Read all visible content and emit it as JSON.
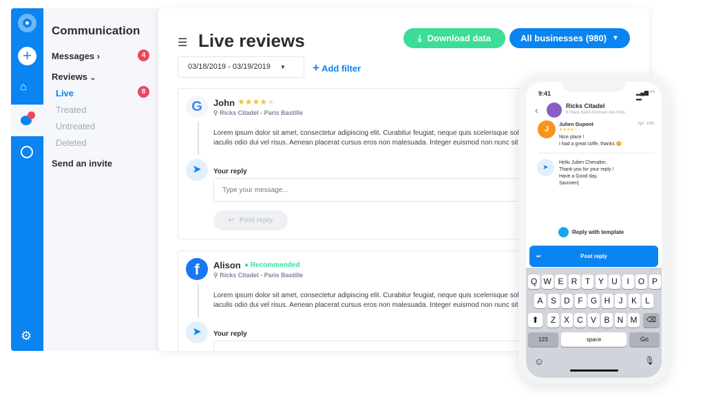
{
  "sidebar": {
    "title": "Communication",
    "items": [
      {
        "label": "Messages",
        "badge": "4"
      },
      {
        "label": "Reviews"
      }
    ],
    "sub_items": [
      {
        "label": "Live",
        "badge": "8"
      },
      {
        "label": "Treated"
      },
      {
        "label": "Untreated"
      },
      {
        "label": "Deleted"
      }
    ],
    "invite": "Send an invite"
  },
  "header": {
    "title": "Live reviews",
    "download": "Download data",
    "businesses": "All businesses (980)",
    "date_range": "03/18/2019 - 03/19/2019",
    "add_filter": "Add filter"
  },
  "reviews": [
    {
      "name": "John",
      "stars": 4,
      "location": "Ricks Citadel - Paris Bastille",
      "source": "google",
      "text1": "Lorem ipsum dolor sit amet, consectetur adipiscing elit. Curabitur feugiat, neque quis scelerisque sollicitudin,",
      "text2": "iaculis odio dui vel risus. Aenean placerat cursus eros non malesuada. Integer euismod non nunc sit amet faci",
      "reply_label": "Your reply",
      "placeholder": "Type your message...",
      "post": "Post reply"
    },
    {
      "name": "Alison",
      "badge": "Recommended",
      "location": "Ricks Citadel - Paris Bastille",
      "source": "facebook",
      "text1": "Lorem ipsum dolor sit amet, consectetur adipiscing elit. Curabitur feugiat, neque quis scelerisque sollicitudin,",
      "text2": "iaculis odio dui vel risus. Aenean placerat cursus eros non malesuada. Integer euismod non nunc sit amet faci",
      "reply_label": "Your reply"
    }
  ],
  "phone": {
    "time": "9:41",
    "business": "Ricks Citadel",
    "address": "6 Place Saint-Germain des Prés",
    "reviewer": "Julien Dupont",
    "initial": "J",
    "date": "Apr. 10th",
    "stars": 4,
    "review1": "Nice place !",
    "review2": "I had a great coffe, thanks 😊",
    "reply": [
      "Hello Julien Chevalier,",
      "Thank you for your reply !",
      "Have a Good day,",
      "Savinien|"
    ],
    "template": "Reply with template",
    "post": "Post reply",
    "keys": {
      "row1": [
        "Q",
        "W",
        "E",
        "R",
        "T",
        "Y",
        "U",
        "I",
        "O",
        "P"
      ],
      "row2": [
        "A",
        "S",
        "D",
        "F",
        "G",
        "H",
        "J",
        "K",
        "L"
      ],
      "row3": [
        "Z",
        "X",
        "C",
        "V",
        "B",
        "N",
        "M"
      ],
      "num": "123",
      "space": "space",
      "go": "Go"
    }
  },
  "colors": {
    "primary": "#0a84f0",
    "green": "#3ddc97",
    "badge": "#f2445f",
    "star": "#f7c31a"
  }
}
